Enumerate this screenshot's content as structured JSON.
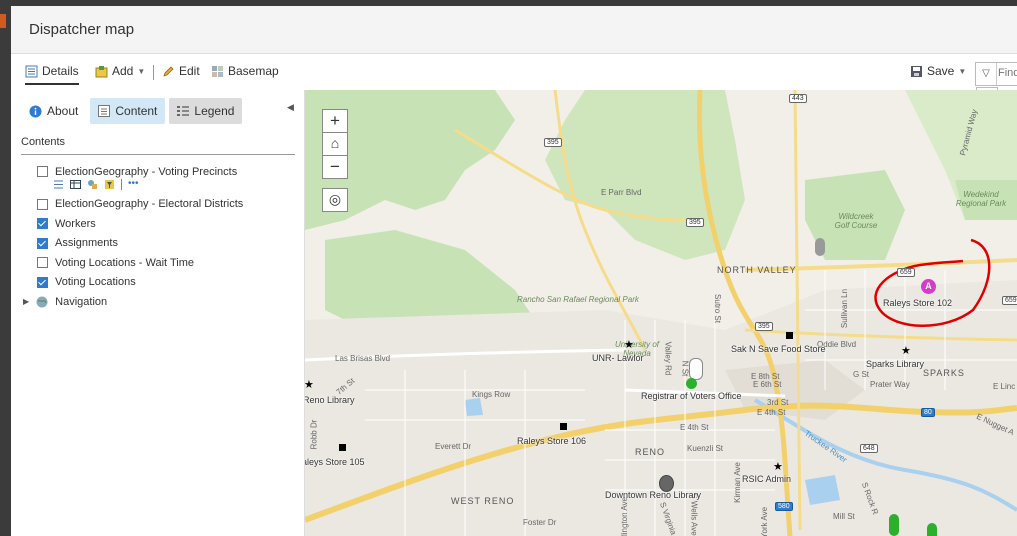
{
  "window": {
    "title": "Dispatcher map"
  },
  "toolbar": {
    "details": "Details",
    "add": "Add",
    "edit": "Edit",
    "basemap": "Basemap",
    "save": "Save",
    "find_placeholder": "Find"
  },
  "panel": {
    "tabs": {
      "about": "About",
      "content": "Content",
      "legend": "Legend"
    },
    "contents_heading": "Contents",
    "layers": [
      {
        "label": "ElectionGeography - Voting Precincts",
        "checked": false
      },
      {
        "label": "ElectionGeography - Electoral Districts",
        "checked": false
      },
      {
        "label": "Workers",
        "checked": true
      },
      {
        "label": "Assignments",
        "checked": true
      },
      {
        "label": "Voting Locations - Wait Time",
        "checked": false
      },
      {
        "label": "Voting Locations",
        "checked": true
      },
      {
        "label": "Navigation",
        "checked": null
      }
    ]
  },
  "map": {
    "points": {
      "raleys_102": "Raleys Store 102",
      "sak_n_save": "Sak N Save Food Store",
      "unr_lawlor": "UNR- Lawlor",
      "registrar": "Registrar of Voters Office",
      "sparks_library": "Sparks Library",
      "reno_library": "Reno Library",
      "raleys_106": "Raleys Store 106",
      "raleys_105": "aleys Store 105",
      "rsic_admin": "RSIC Admin",
      "downtown_library": "Downtown Reno Library"
    },
    "areas": {
      "north_valley": "NORTH VALLEY",
      "sparks": "SPARKS",
      "reno": "RENO",
      "west_reno": "WEST RENO",
      "rancho": "Rancho San Rafael Regional Park",
      "wildcreek": "Wildcreek Golf Course",
      "wedekind": "Wedekind Regional Park",
      "unr": "University of Nevada"
    },
    "streets": {
      "e_parr": "E Parr Blvd",
      "las_brisas": "Las Brisas Blvd",
      "kings_row": "Kings Row",
      "everett": "Everett Dr",
      "e_4th": "E 4th St",
      "e_6th": "E 6th St",
      "kuenzli": "Kuenzli St",
      "mill": "Mill St",
      "foster": "Foster Dr",
      "prater": "Prater Way",
      "g_st": "G St",
      "sullivan": "Sullivan Ln",
      "sutro": "Sutro St",
      "pyramid": "Pyramid Way",
      "valley": "Valley Rd",
      "kirman": "Kirman Ave",
      "york": "York Ave",
      "wells": "S Wells Ave",
      "virginia": "S Virginia",
      "arlington": "Arlington Ave",
      "robb": "Robb Dr",
      "7th": "7th St",
      "e_lincoln": "E Linc",
      "e_nugget": "E Nugget A",
      "truckee": "Truckee River",
      "rock": "S Rock R",
      "n_st": "N St",
      "st_3": "3rd St",
      "e_8th": "E 8th St",
      "oddie": "Oddie Blvd"
    },
    "shields": {
      "s443": "443",
      "s395a": "395",
      "s395b": "395",
      "s395c": "395",
      "s659": "659",
      "s659b": "659",
      "s648": "648",
      "s80": "80",
      "s580": "580"
    }
  }
}
